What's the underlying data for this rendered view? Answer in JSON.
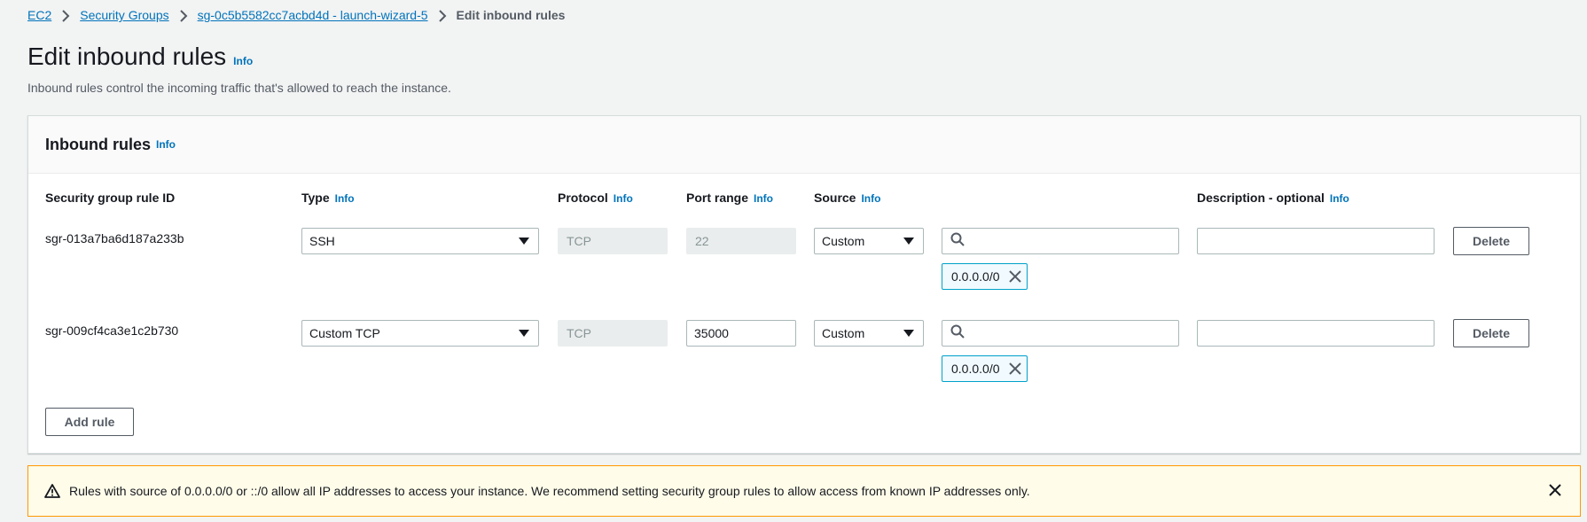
{
  "breadcrumb": {
    "items": [
      "EC2",
      "Security Groups",
      "sg-0c5b5582cc7acbd4d - launch-wizard-5"
    ],
    "current": "Edit inbound rules"
  },
  "page": {
    "title": "Edit inbound rules",
    "info": "Info",
    "description": "Inbound rules control the incoming traffic that's allowed to reach the instance."
  },
  "panel": {
    "title": "Inbound rules",
    "info": "Info",
    "columns": {
      "rule_id": "Security group rule ID",
      "type": "Type",
      "protocol": "Protocol",
      "port_range": "Port range",
      "source": "Source",
      "description": "Description - optional",
      "info": "Info"
    },
    "rules": [
      {
        "rule_id": "sgr-013a7ba6d187a233b",
        "type": "SSH",
        "protocol": "TCP",
        "port_range": "22",
        "source": "Custom",
        "cidr": "0.0.0.0/0",
        "description": "",
        "delete_label": "Delete"
      },
      {
        "rule_id": "sgr-009cf4ca3e1c2b730",
        "type": "Custom TCP",
        "protocol": "TCP",
        "port_range": "35000",
        "source": "Custom",
        "cidr": "0.0.0.0/0",
        "description": "",
        "delete_label": "Delete"
      }
    ],
    "add_rule_label": "Add rule"
  },
  "warning": {
    "text": "Rules with source of 0.0.0.0/0 or ::/0 allow all IP addresses to access your instance. We recommend setting security group rules to allow access from known IP addresses only."
  },
  "colors": {
    "link": "#0073bb",
    "token_border": "#00a1c9",
    "warning_border": "#ff9900",
    "warning_bg": "#fffce9"
  },
  "icons": [
    "chevron-right-icon",
    "search-icon",
    "close-icon",
    "warning-icon"
  ]
}
